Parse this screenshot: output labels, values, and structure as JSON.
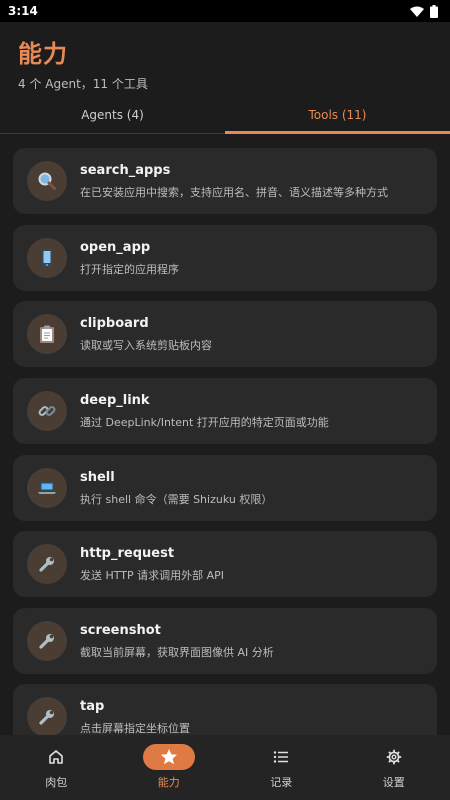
{
  "status": {
    "time": "3:14"
  },
  "header": {
    "title": "能力",
    "subtitle": "4 个 Agent，11 个工具"
  },
  "tabs": [
    {
      "label": "Agents (4)",
      "active": false
    },
    {
      "label": "Tools (11)",
      "active": true
    }
  ],
  "tools": [
    {
      "name": "search_apps",
      "description": "在已安装应用中搜索，支持应用名、拼音、语义描述等多种方式",
      "icon": "magnifier-icon"
    },
    {
      "name": "open_app",
      "description": "打开指定的应用程序",
      "icon": "mobile-phone-icon"
    },
    {
      "name": "clipboard",
      "description": "读取或写入系统剪贴板内容",
      "icon": "clipboard-icon"
    },
    {
      "name": "deep_link",
      "description": "通过 DeepLink/Intent 打开应用的特定页面或功能",
      "icon": "link-icon"
    },
    {
      "name": "shell",
      "description": "执行 shell 命令（需要 Shizuku 权限）",
      "icon": "laptop-icon"
    },
    {
      "name": "http_request",
      "description": "发送 HTTP 请求调用外部 API",
      "icon": "wrench-icon"
    },
    {
      "name": "screenshot",
      "description": "截取当前屏幕，获取界面图像供 AI 分析",
      "icon": "wrench-icon"
    },
    {
      "name": "tap",
      "description": "点击屏幕指定坐标位置",
      "icon": "wrench-icon"
    }
  ],
  "bottom_nav": [
    {
      "label": "肉包",
      "icon": "home-icon",
      "active": false
    },
    {
      "label": "能力",
      "icon": "star-icon",
      "active": true
    },
    {
      "label": "记录",
      "icon": "list-icon",
      "active": false
    },
    {
      "label": "设置",
      "icon": "gear-icon",
      "active": false
    }
  ],
  "colors": {
    "accent": "#e88a55",
    "background": "#1c1c1c",
    "card": "#2a2a2a"
  }
}
